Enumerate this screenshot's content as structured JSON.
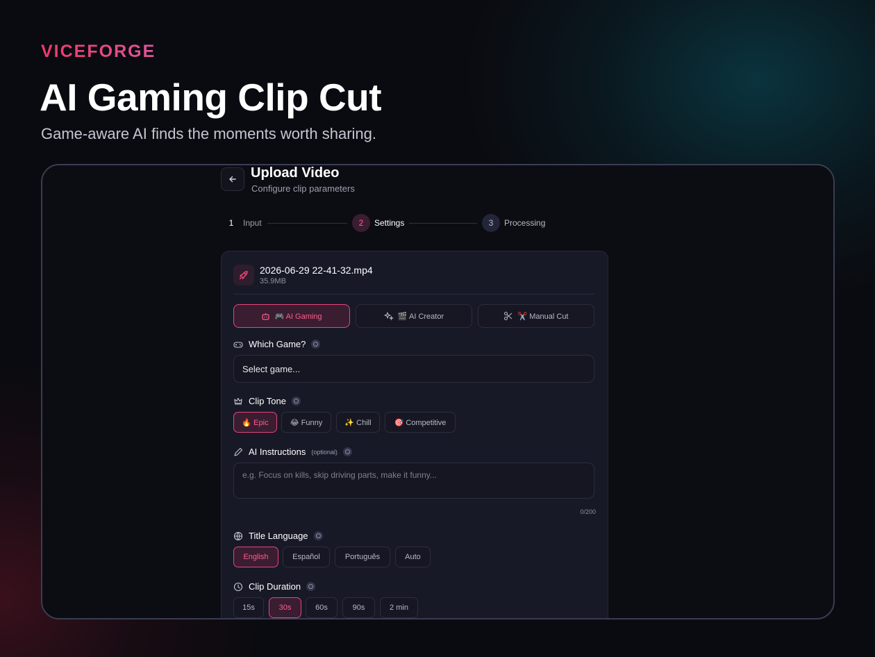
{
  "brand": "VICEFORGE",
  "hero": {
    "title": "AI Gaming Clip Cut",
    "subtitle": "Game-aware AI finds the moments worth sharing."
  },
  "page": {
    "title": "Upload Video",
    "subtitle": "Configure clip parameters"
  },
  "stepper": {
    "steps": [
      {
        "number": "1",
        "label": "Input",
        "state": "done"
      },
      {
        "number": "2",
        "label": "Settings",
        "state": "active"
      },
      {
        "number": "3",
        "label": "Processing",
        "state": "pending"
      }
    ]
  },
  "file": {
    "name": "2026-06-29 22-41-32.mp4",
    "size": "35.9MB",
    "icon": "rocket-icon"
  },
  "modes": [
    {
      "label": "🎮 AI Gaming",
      "icon": "robot-icon",
      "active": true
    },
    {
      "label": "🎬 AI Creator",
      "icon": "sparkles-icon",
      "active": false
    },
    {
      "label": "✂️ Manual Cut",
      "icon": "scissors-icon",
      "active": false
    }
  ],
  "game": {
    "label": "Which Game?",
    "icon": "gamepad-icon",
    "value": "Select game..."
  },
  "tone": {
    "label": "Clip Tone",
    "icon": "crown-icon",
    "options": [
      {
        "label": "🔥 Epic",
        "active": true
      },
      {
        "label": "😂 Funny",
        "active": false
      },
      {
        "label": "✨ Chill",
        "active": false
      },
      {
        "label": "🎯 Competitive",
        "active": false
      }
    ]
  },
  "instructions": {
    "label": "AI Instructions",
    "optional": "(optional)",
    "icon": "pencil-icon",
    "placeholder": "e.g. Focus on kills, skip driving parts, make it funny...",
    "counter": "0/200"
  },
  "language": {
    "label": "Title Language",
    "icon": "globe-icon",
    "options": [
      {
        "label": "English",
        "active": true
      },
      {
        "label": "Español",
        "active": false
      },
      {
        "label": "Português",
        "active": false
      },
      {
        "label": "Auto",
        "active": false
      }
    ]
  },
  "duration": {
    "label": "Clip Duration",
    "icon": "clock-icon",
    "options": [
      {
        "label": "15s",
        "active": false
      },
      {
        "label": "30s",
        "active": true
      },
      {
        "label": "60s",
        "active": false
      },
      {
        "label": "90s",
        "active": false
      },
      {
        "label": "2 min",
        "active": false
      }
    ]
  },
  "colors": {
    "accent": "#f0386b",
    "card_bg": "#181927",
    "page_bg": "#0a0b10"
  }
}
